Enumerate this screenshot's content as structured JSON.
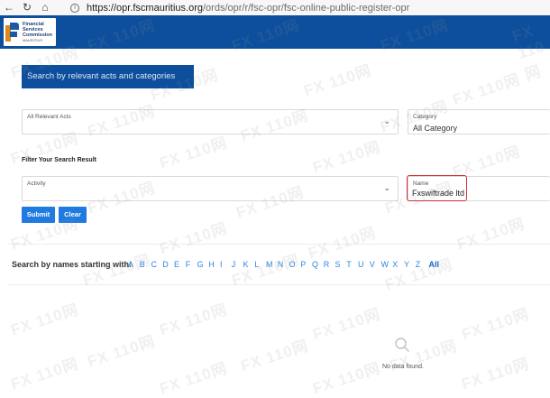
{
  "browser": {
    "url_host": "https://opr.fscmauritius.org",
    "url_path": "/ords/opr/r/fsc-opr/fsc-online-public-register-opr"
  },
  "logo": {
    "line1": "Financial",
    "line2": "Services",
    "line3": "Commission",
    "line4": "MAURITIUS"
  },
  "search_banner": "Search by relevant acts and categories",
  "acts_select": {
    "label": "All Relevant Acts",
    "value": ""
  },
  "category_select": {
    "label": "Category",
    "value": "All Category"
  },
  "filter_title": "Filter Your Search Result",
  "activity_select": {
    "label": "Activity",
    "value": ""
  },
  "name_field": {
    "label": "Name",
    "value": "Fxswiftrade ltd"
  },
  "buttons": {
    "submit": "Submit",
    "clear": "Clear"
  },
  "alphabet": {
    "label": "Search by names starting with:",
    "letters": [
      "A",
      "B",
      "C",
      "D",
      "E",
      "F",
      "G",
      "H",
      "I",
      "J",
      "K",
      "L",
      "M",
      "N",
      "O",
      "P",
      "Q",
      "R",
      "S",
      "T",
      "U",
      "V",
      "W",
      "X",
      "Y",
      "Z"
    ],
    "all": "All"
  },
  "results": {
    "empty_text": "No data found."
  },
  "watermark": "FX 110网",
  "colors": {
    "header": "#0d4f9c",
    "button": "#1f7be0",
    "link": "#2d86e0",
    "highlight_border": "#e53935"
  }
}
